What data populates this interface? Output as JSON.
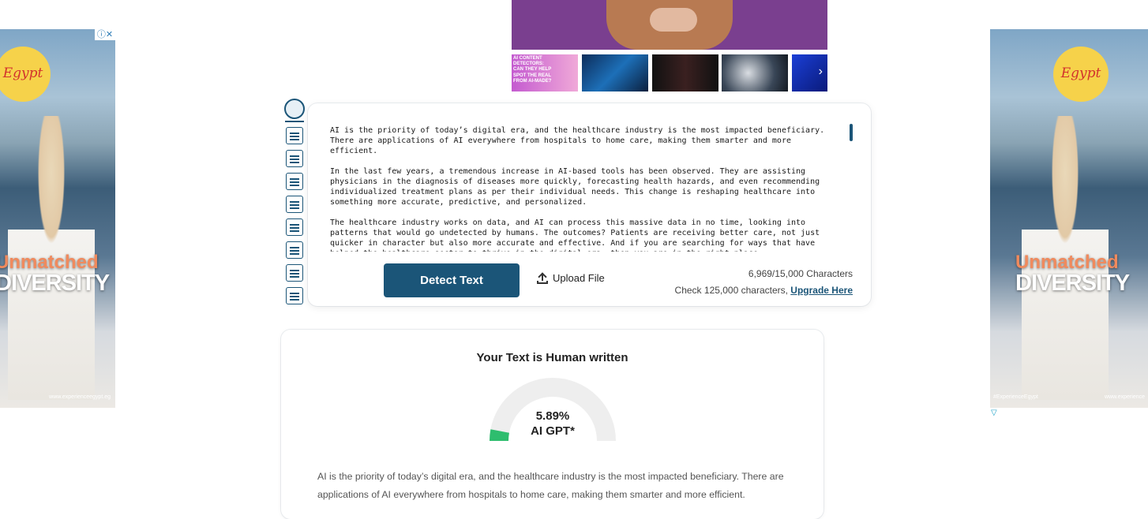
{
  "ads": {
    "left": {
      "brand": "Egypt",
      "headline_1": "Unmatched",
      "headline_2": "DIVERSITY",
      "url": "www.experienceegypt.eg",
      "close": "ⓘ✕"
    },
    "right": {
      "brand": "Egypt",
      "headline_1": "Unmatched",
      "headline_2": "DIVERSITY",
      "hashtag": "#ExperienceEgypt",
      "url": "www.experience"
    },
    "thumb_1_text": "AI CONTENT DETECTORS: CAN THEY HELP SPOT THE REAL FROM AI-MADE?"
  },
  "tool_rail": {
    "icons": [
      "ai-chat-icon",
      "search-document-icon",
      "document-icon",
      "image-text-icon",
      "check-document-icon",
      "translate-icon",
      "compare-icon",
      "email-icon"
    ]
  },
  "input": {
    "paragraphs": [
      "AI is the priority of today’s digital era, and the healthcare industry is the most impacted beneficiary. There are applications of AI everywhere from hospitals to home care, making them smarter and more efficient.",
      "In the last few years, a tremendous increase in AI-based tools has been observed. They are assisting physicians in the diagnosis of diseases more quickly, forecasting health hazards, and even recommending individualized treatment plans as per their individual needs. This change is reshaping healthcare into something more accurate, predictive, and personalized.",
      "The healthcare industry works on data, and AI can process this massive data in no time, looking into patterns that would go undetected by humans. The outcomes? Patients are receiving better care, not just quicker in character but also more accurate and effective. And if you are searching for ways that have helped the healthcare sector to thrive in the digital era, then you are in the right place."
    ],
    "detect_label": "Detect Text",
    "upload_label": "Upload File",
    "char_count": "6,969/15,000 Characters",
    "check_text": "Check 125,000 characters, ",
    "upgrade_label": "Upgrade Here"
  },
  "result": {
    "title": "Your Text is Human written",
    "percent": "5.89%",
    "percent_value": 0.0589,
    "gauge_label": "AI GPT*",
    "gauge_color": "#2ebd6e",
    "body": "AI is the priority of today’s digital era, and the healthcare industry is the most impacted beneficiary. There are applications of AI everywhere from hospitals to home care, making them smarter and more efficient."
  }
}
